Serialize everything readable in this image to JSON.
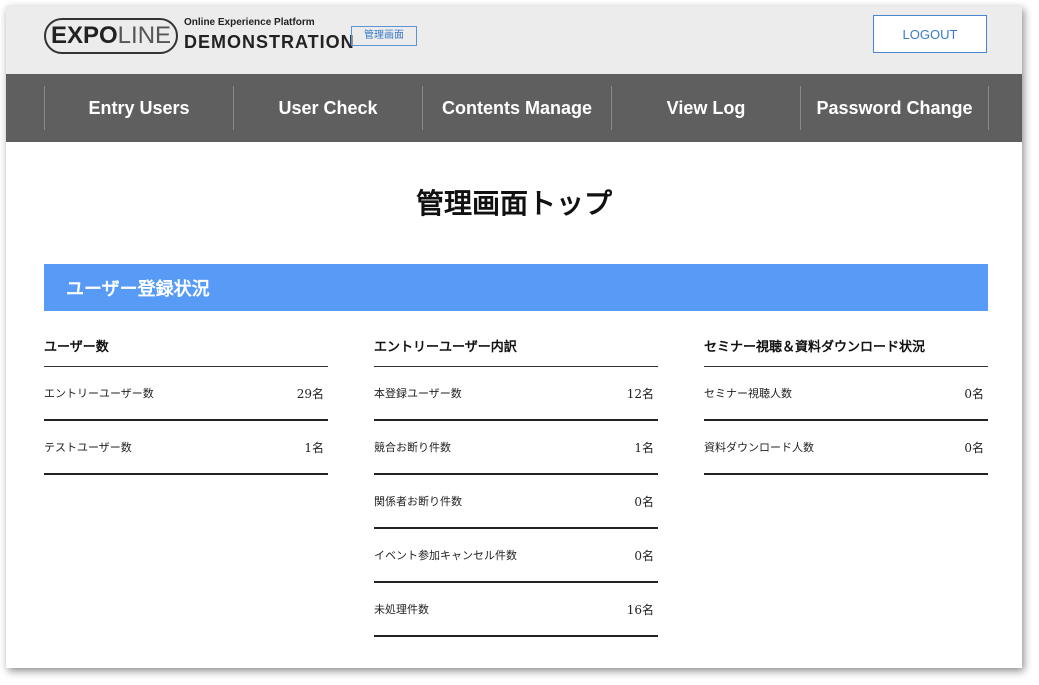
{
  "header": {
    "logo_part1": "EXPO",
    "logo_part2": "LINE",
    "platform": "Online Experience Platform",
    "demo": "DEMONSTRATION",
    "admin_badge": "管理画面",
    "logout_label": "LOGOUT"
  },
  "nav": {
    "items": [
      "Entry Users",
      "User Check",
      "Contents Manage",
      "View Log",
      "Password Change"
    ]
  },
  "page_title": "管理画面トップ",
  "section": {
    "title": "ユーザー登録状況"
  },
  "columns": [
    {
      "title": "ユーザー数",
      "rows": [
        {
          "label": "エントリーユーザー数",
          "value": "29名"
        },
        {
          "label": "テストユーザー数",
          "value": "1名"
        }
      ]
    },
    {
      "title": "エントリーユーザー内訳",
      "rows": [
        {
          "label": "本登録ユーザー数",
          "value": "12名"
        },
        {
          "label": "競合お断り件数",
          "value": "1名"
        },
        {
          "label": "関係者お断り件数",
          "value": "0名"
        },
        {
          "label": "イベント参加キャンセル件数",
          "value": "0名"
        },
        {
          "label": "未処理件数",
          "value": "16名"
        }
      ]
    },
    {
      "title": "セミナー視聴＆資料ダウンロード状況",
      "rows": [
        {
          "label": "セミナー視聴人数",
          "value": "0名"
        },
        {
          "label": "資料ダウンロード人数",
          "value": "0名"
        }
      ]
    }
  ]
}
